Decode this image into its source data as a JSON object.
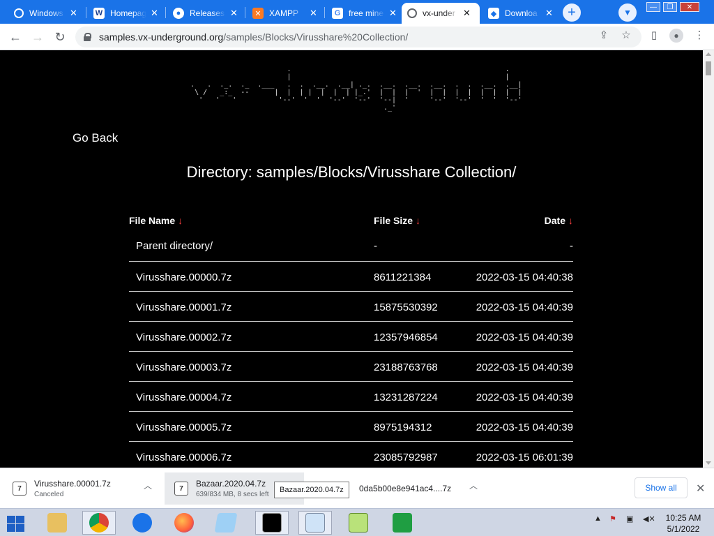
{
  "browser": {
    "tabs": [
      {
        "label": "Windows",
        "icon": "windows-icon",
        "active": false
      },
      {
        "label": "Homepage",
        "icon": "homepage-icon",
        "active": false
      },
      {
        "label": "Releases",
        "icon": "github-icon",
        "active": false
      },
      {
        "label": "XAMPP",
        "icon": "xampp-icon",
        "active": false
      },
      {
        "label": "free mine",
        "icon": "google-icon",
        "active": false
      },
      {
        "label": "vx-under",
        "icon": "globe-icon",
        "active": true
      },
      {
        "label": "Downloa",
        "icon": "shield-icon",
        "active": false
      }
    ],
    "new_tab_symbol": "+",
    "url_domain": "samples.vx-underground.org",
    "url_path": "/samples/Blocks/Virusshare%20Collection/",
    "accent_color": "#1a73e8"
  },
  "page": {
    "ascii_logo": "                          .                                                   .\n                          |                                                   |\n   .   .  ._.  ._  .___   .  .  .__.  .__| ._.  .__.  .__.  .__.  .  .  .__.  .__|\n    \\ /   _:_  --      |  |  | |  |  |  | |_.'  |  |  |  '  |  |  |  |  |  |  |  |\n     '   '   '          '--'  '  '  '--'  '--'  '--|  '     '--'  '--'  '  '  '--'\n                                                 ._'",
    "go_back": "Go Back",
    "directory_title": "Directory: samples/Blocks/Virusshare Collection/",
    "table": {
      "headers": {
        "name": "File Name",
        "size": "File Size",
        "date": "Date",
        "sort_arrow": "↓"
      },
      "rows": [
        {
          "name": "Parent directory/",
          "size": "-",
          "date": "-"
        },
        {
          "name": "Virusshare.00000.7z",
          "size": "8611221384",
          "date": "2022-03-15 04:40:38"
        },
        {
          "name": "Virusshare.00001.7z",
          "size": "15875530392",
          "date": "2022-03-15 04:40:39"
        },
        {
          "name": "Virusshare.00002.7z",
          "size": "12357946854",
          "date": "2022-03-15 04:40:39"
        },
        {
          "name": "Virusshare.00003.7z",
          "size": "23188763768",
          "date": "2022-03-15 04:40:39"
        },
        {
          "name": "Virusshare.00004.7z",
          "size": "13231287224",
          "date": "2022-03-15 04:40:39"
        },
        {
          "name": "Virusshare.00005.7z",
          "size": "8975194312",
          "date": "2022-03-15 04:40:39"
        },
        {
          "name": "Virusshare.00006.7z",
          "size": "23085792987",
          "date": "2022-03-15 06:01:39"
        }
      ]
    }
  },
  "downloads": {
    "items": [
      {
        "name": "Virusshare.00001.7z",
        "status": "Canceled"
      },
      {
        "name": "Bazaar.2020.04.7z",
        "status": "639/834 MB, 8 secs left"
      },
      {
        "name": "0da5b00e8e941ac4....7z",
        "status": ""
      }
    ],
    "tooltip": "Bazaar.2020.04.7z",
    "show_all": "Show all"
  },
  "taskbar": {
    "time": "10:25 AM",
    "date": "5/1/2022"
  }
}
